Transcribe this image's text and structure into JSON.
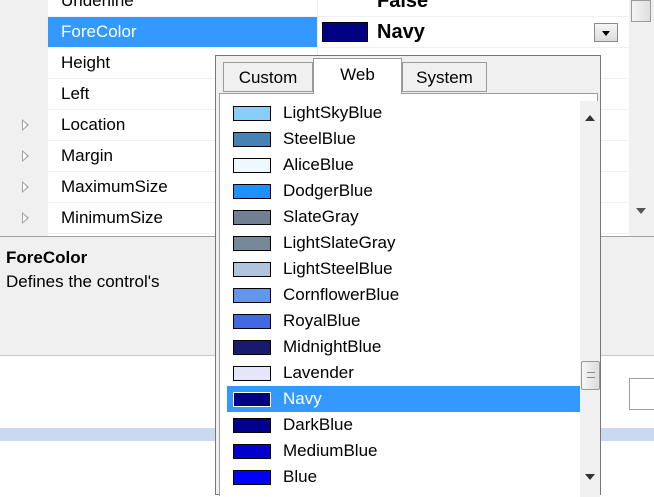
{
  "grid": {
    "rows": [
      {
        "name": "Underline",
        "value": "False"
      },
      {
        "name": "ForeColor",
        "value": "Navy",
        "swatch": "#000080",
        "selected": true
      },
      {
        "name": "Height",
        "value": ""
      },
      {
        "name": "Left",
        "value": ""
      },
      {
        "name": "Location",
        "value": "",
        "expandable": true
      },
      {
        "name": "Margin",
        "value": "",
        "expandable": true
      },
      {
        "name": "MaximumSize",
        "value": "",
        "expandable": true
      },
      {
        "name": "MinimumSize",
        "value": "",
        "expandable": true
      }
    ]
  },
  "description": {
    "title": "ForeColor",
    "text": "Defines the control's"
  },
  "popup": {
    "tabs": [
      "Custom",
      "Web",
      "System"
    ],
    "active_tab": "Web",
    "selected_color": "Navy",
    "colors": [
      {
        "name": "LightSkyBlue",
        "hex": "#87cefa"
      },
      {
        "name": "SteelBlue",
        "hex": "#4682b4"
      },
      {
        "name": "AliceBlue",
        "hex": "#f0f8ff"
      },
      {
        "name": "DodgerBlue",
        "hex": "#1e90ff"
      },
      {
        "name": "SlateGray",
        "hex": "#708090"
      },
      {
        "name": "LightSlateGray",
        "hex": "#778899"
      },
      {
        "name": "LightSteelBlue",
        "hex": "#b0c4de"
      },
      {
        "name": "CornflowerBlue",
        "hex": "#6495ed"
      },
      {
        "name": "RoyalBlue",
        "hex": "#4169e1"
      },
      {
        "name": "MidnightBlue",
        "hex": "#191970"
      },
      {
        "name": "Lavender",
        "hex": "#e6e6fa"
      },
      {
        "name": "Navy",
        "hex": "#000080"
      },
      {
        "name": "DarkBlue",
        "hex": "#00008b"
      },
      {
        "name": "MediumBlue",
        "hex": "#0000cd"
      },
      {
        "name": "Blue",
        "hex": "#0000ff"
      }
    ]
  },
  "colors": {
    "selection": "#3399ff",
    "panel": "#f0f0f0"
  }
}
